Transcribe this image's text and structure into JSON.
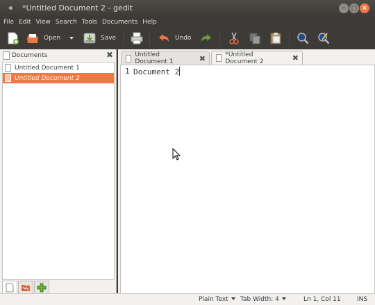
{
  "window": {
    "title": "*Untitled Document 2 - gedit"
  },
  "menu": [
    "File",
    "Edit",
    "View",
    "Search",
    "Tools",
    "Documents",
    "Help"
  ],
  "toolbar": {
    "open_label": "Open",
    "save_label": "Save",
    "undo_label": "Undo"
  },
  "side_panel": {
    "title": "Documents",
    "documents": [
      {
        "label": "Untitled Document 1"
      },
      {
        "label": "Untitled Document 2"
      }
    ]
  },
  "tabs": [
    {
      "label": "Untitled Document 1"
    },
    {
      "label": "*Untitled Document 2"
    }
  ],
  "editor": {
    "line_number": "1",
    "content": "Document 2"
  },
  "status": {
    "language": "Plain Text",
    "tab_width": "Tab Width:  4",
    "position": "Ln 1, Col 11",
    "mode": "INS"
  },
  "colors": {
    "accent": "#f07746",
    "chrome": "#3c3b37"
  }
}
